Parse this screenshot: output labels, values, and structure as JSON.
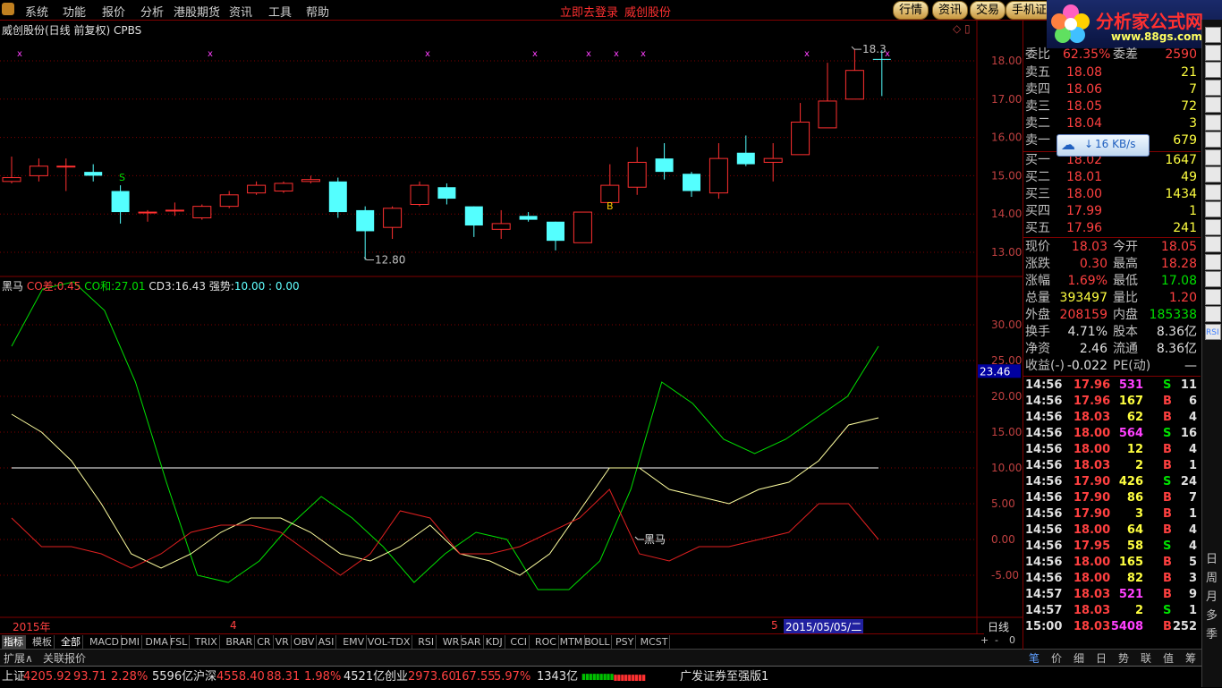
{
  "menu": {
    "items": [
      "系统",
      "功能",
      "报价",
      "分析",
      "港股期货",
      "资讯",
      "工具",
      "帮助"
    ],
    "center_links": [
      "立即去登录",
      "威创股份"
    ],
    "right_buttons": [
      "行情",
      "资讯",
      "交易",
      "手机证"
    ]
  },
  "logo": {
    "title": "分析家公式网",
    "url": "www.88gs.com"
  },
  "chart": {
    "title": "威创股份(日线 前复权) CPBS",
    "price_labels": [
      "18.00",
      "17.00",
      "16.00",
      "15.00",
      "14.00",
      "13.00"
    ],
    "low_mark": "12.80",
    "high_mark": "18.3",
    "buy_mark": "B",
    "sell_mark": "S",
    "candles": [
      {
        "o": 14.85,
        "c": 14.95,
        "h": 15.5,
        "l": 14.8
      },
      {
        "o": 15.0,
        "c": 15.25,
        "h": 15.45,
        "l": 14.85
      },
      {
        "o": 15.25,
        "c": 15.25,
        "h": 15.45,
        "l": 14.6
      },
      {
        "o": 15.1,
        "c": 15.0,
        "h": 15.3,
        "l": 14.85
      },
      {
        "o": 14.6,
        "c": 14.05,
        "h": 14.75,
        "l": 13.75
      },
      {
        "o": 14.05,
        "c": 14.05,
        "h": 14.1,
        "l": 13.8
      },
      {
        "o": 14.1,
        "c": 14.1,
        "h": 14.3,
        "l": 13.95
      },
      {
        "o": 13.9,
        "c": 14.2,
        "h": 14.25,
        "l": 13.85
      },
      {
        "o": 14.2,
        "c": 14.5,
        "h": 14.6,
        "l": 14.15
      },
      {
        "o": 14.55,
        "c": 14.75,
        "h": 14.85,
        "l": 14.5
      },
      {
        "o": 14.6,
        "c": 14.8,
        "h": 14.85,
        "l": 14.55
      },
      {
        "o": 14.85,
        "c": 14.9,
        "h": 15.0,
        "l": 14.8
      },
      {
        "o": 14.85,
        "c": 14.05,
        "h": 14.95,
        "l": 13.9
      },
      {
        "o": 14.1,
        "c": 13.55,
        "h": 14.2,
        "l": 12.8
      },
      {
        "o": 13.65,
        "c": 14.15,
        "h": 14.2,
        "l": 13.35
      },
      {
        "o": 14.25,
        "c": 14.75,
        "h": 14.85,
        "l": 14.2
      },
      {
        "o": 14.7,
        "c": 14.4,
        "h": 14.8,
        "l": 14.25
      },
      {
        "o": 14.2,
        "c": 13.7,
        "h": 14.2,
        "l": 13.4
      },
      {
        "o": 13.6,
        "c": 13.75,
        "h": 14.1,
        "l": 13.35
      },
      {
        "o": 13.95,
        "c": 13.85,
        "h": 14.05,
        "l": 13.8
      },
      {
        "o": 13.8,
        "c": 13.3,
        "h": 13.8,
        "l": 13.05
      },
      {
        "o": 13.25,
        "c": 14.05,
        "h": 14.05,
        "l": 13.25
      },
      {
        "o": 14.3,
        "c": 14.75,
        "h": 15.3,
        "l": 14.3
      },
      {
        "o": 14.7,
        "c": 15.35,
        "h": 15.75,
        "l": 14.5
      },
      {
        "o": 15.45,
        "c": 15.1,
        "h": 15.85,
        "l": 14.9
      },
      {
        "o": 15.05,
        "c": 14.6,
        "h": 15.1,
        "l": 14.45
      },
      {
        "o": 14.55,
        "c": 15.45,
        "h": 15.85,
        "l": 14.4
      },
      {
        "o": 15.6,
        "c": 15.3,
        "h": 16.05,
        "l": 15.25
      },
      {
        "o": 15.35,
        "c": 15.45,
        "h": 15.85,
        "l": 14.85
      },
      {
        "o": 15.55,
        "c": 16.4,
        "h": 16.9,
        "l": 15.55
      },
      {
        "o": 16.25,
        "c": 16.95,
        "h": 17.95,
        "l": 16.25
      },
      {
        "o": 17.0,
        "c": 17.75,
        "h": 18.3,
        "l": 17.0
      },
      {
        "o": 18.05,
        "c": 18.03,
        "h": 18.28,
        "l": 17.08
      }
    ]
  },
  "indicator": {
    "name": "黑马",
    "co_diff_label": "CO差:",
    "co_diff": "0.45",
    "co_sum_label": "CO和:",
    "co_sum": "27.01",
    "cd3_label": "CD3:",
    "cd3": "16.43",
    "strength_label": "强势:",
    "strength": "10.00 : 0.00",
    "y_labels": [
      "30.00",
      "25.00",
      "20.00",
      "15.00",
      "10.00",
      "5.00",
      "0.00",
      "-5.00"
    ],
    "current": "23.46",
    "mark": "黑马",
    "green": [
      27,
      35,
      36,
      32,
      22,
      8,
      -5,
      -6,
      -3,
      2,
      6,
      3,
      -1,
      -6,
      -2,
      1,
      0,
      -7,
      -7,
      -3,
      7,
      22,
      19,
      14,
      12,
      14,
      17,
      20,
      27
    ],
    "yellow": [
      17.5,
      15,
      11,
      5,
      -2,
      -4,
      -2,
      1,
      3,
      3,
      1,
      -2,
      -3,
      -1,
      2,
      -2,
      -3,
      -5,
      -2,
      4,
      10,
      10,
      7,
      6,
      5,
      7,
      8,
      11,
      16,
      17
    ],
    "red": [
      3,
      -1,
      -1,
      -2,
      -4,
      -2,
      1,
      2,
      2,
      1,
      -2,
      -5,
      -2,
      4,
      3,
      -2,
      -2,
      -1,
      1,
      3,
      7,
      -2,
      -3,
      -1,
      -1,
      0,
      1,
      5,
      5,
      0
    ],
    "line_level": 10
  },
  "timeaxis": {
    "year": "2015年",
    "m4": "4",
    "m5": "5",
    "date": "2015/05/05/二",
    "period": "日线"
  },
  "quote": {
    "weibi_label": "委比",
    "weibi": "62.35%",
    "weicha_label": "委差",
    "weicha": "2590",
    "sell": [
      {
        "label": "卖五",
        "price": "18.08",
        "vol": "21"
      },
      {
        "label": "卖四",
        "price": "18.06",
        "vol": "7"
      },
      {
        "label": "卖三",
        "price": "18.05",
        "vol": "72"
      },
      {
        "label": "卖二",
        "price": "18.04",
        "vol": "3"
      },
      {
        "label": "卖一",
        "price": "",
        "vol": "679"
      }
    ],
    "buy": [
      {
        "label": "买一",
        "price": "18.02",
        "vol": "1647"
      },
      {
        "label": "买二",
        "price": "18.01",
        "vol": "49"
      },
      {
        "label": "买三",
        "price": "18.00",
        "vol": "1434"
      },
      {
        "label": "买四",
        "price": "17.99",
        "vol": "1"
      },
      {
        "label": "买五",
        "price": "17.96",
        "vol": "241"
      }
    ],
    "speed": "16 KB/s",
    "stats": [
      [
        "现价",
        "18.03",
        "今开",
        "18.05"
      ],
      [
        "涨跌",
        "0.30",
        "最高",
        "18.28"
      ],
      [
        "涨幅",
        "1.69%",
        "最低",
        "17.08"
      ],
      [
        "总量",
        "393497",
        "量比",
        "1.20"
      ],
      [
        "外盘",
        "208159",
        "内盘",
        "185338"
      ],
      [
        "换手",
        "4.71%",
        "股本",
        "8.36亿"
      ],
      [
        "净资",
        "2.46",
        "流通",
        "8.36亿"
      ],
      [
        "收益(-)",
        "-0.022",
        "PE(动)",
        "—"
      ]
    ],
    "ticks": [
      [
        "14:56",
        "17.96",
        "531",
        "S",
        "11"
      ],
      [
        "14:56",
        "17.96",
        "167",
        "B",
        "6"
      ],
      [
        "14:56",
        "18.03",
        "62",
        "B",
        "4"
      ],
      [
        "14:56",
        "18.00",
        "564",
        "S",
        "16"
      ],
      [
        "14:56",
        "18.00",
        "12",
        "B",
        "4"
      ],
      [
        "14:56",
        "18.03",
        "2",
        "B",
        "1"
      ],
      [
        "14:56",
        "17.90",
        "426",
        "S",
        "24"
      ],
      [
        "14:56",
        "17.90",
        "86",
        "B",
        "7"
      ],
      [
        "14:56",
        "17.90",
        "3",
        "B",
        "1"
      ],
      [
        "14:56",
        "18.00",
        "64",
        "B",
        "4"
      ],
      [
        "14:56",
        "17.95",
        "58",
        "S",
        "4"
      ],
      [
        "14:56",
        "18.00",
        "165",
        "B",
        "5"
      ],
      [
        "14:56",
        "18.00",
        "82",
        "B",
        "3"
      ],
      [
        "14:57",
        "18.03",
        "521",
        "B",
        "9"
      ],
      [
        "14:57",
        "18.03",
        "2",
        "S",
        "1"
      ],
      [
        "15:00",
        "18.03",
        "5408",
        "B",
        "252"
      ]
    ]
  },
  "tabs": [
    "指标",
    "模板",
    "全部",
    "MACD",
    "DMI",
    "DMA",
    "FSL",
    "TRIX",
    "BRAR",
    "CR",
    "VR",
    "OBV",
    "ASI",
    "EMV",
    "VOL-TDX",
    "RSI",
    "WR",
    "SAR",
    "KDJ",
    "CCI",
    "ROC",
    "MTM",
    "BOLL",
    "PSY",
    "MCST"
  ],
  "tab_controls": [
    "+",
    "-",
    "0"
  ],
  "bottom_tabs": [
    "扩展∧",
    "关联报价"
  ],
  "right_bottom_tabs": [
    "笔",
    "价",
    "细",
    "日",
    "势",
    "联",
    "值",
    "筹"
  ],
  "sidebar_text": [
    "日",
    "周",
    "月",
    "多",
    "季"
  ],
  "rsi_label": "RSI",
  "status": {
    "sh_label": "上证",
    "sh": "4205.92",
    "sh_chg": "93.71",
    "sh_pct": "2.28%",
    "sh_amt": "5596亿",
    "hs_label": "沪深",
    "hs": "4558.40",
    "hs_chg": "88.31",
    "hs_pct": "1.98%",
    "hs_amt": "4521亿",
    "cy_label": "创业",
    "cy": "2973.60",
    "cy_chg": "167.55",
    "cy_pct": "5.97%",
    "cy_amt": "1343亿",
    "broker": "广发证券至强版1"
  }
}
